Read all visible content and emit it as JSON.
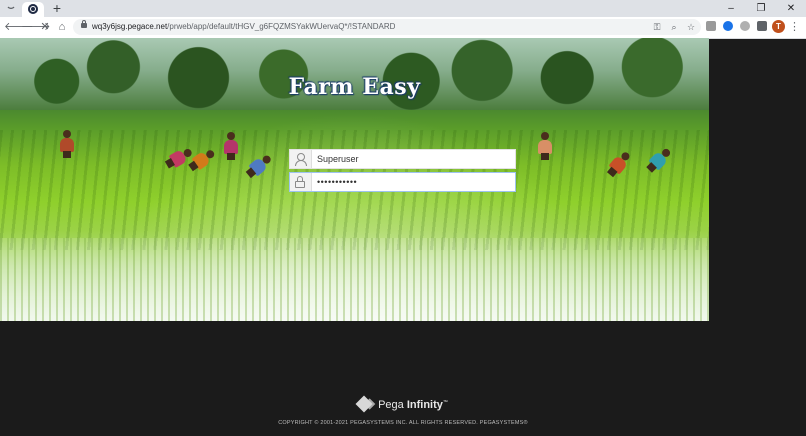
{
  "browser": {
    "url_host": "wq3y6jsg.pegace.net",
    "url_path": "/prweb/app/default/tHGV_g6FQZMSYakWUervaQ*/!STANDARD",
    "window_controls": {
      "minimize": "–",
      "restore": "❐",
      "close": "✕"
    },
    "profile_initial": "T"
  },
  "page": {
    "app_title": "Farm Easy",
    "login": {
      "username_value": "Superuser",
      "password_value": "•••••••••••"
    },
    "footer": {
      "brand_prefix": "Pega ",
      "brand_suffix": "Infinity",
      "trademark": "™",
      "copyright": "COPYRIGHT © 2001-2021 PEGASYSTEMS INC. ALL RIGHTS RESERVED. PEGASYSTEMS®"
    }
  },
  "colors": {
    "profile_avatar": "#c0501c",
    "page_background": "#1b1b1b",
    "title_outline": "#1a3a6a"
  }
}
